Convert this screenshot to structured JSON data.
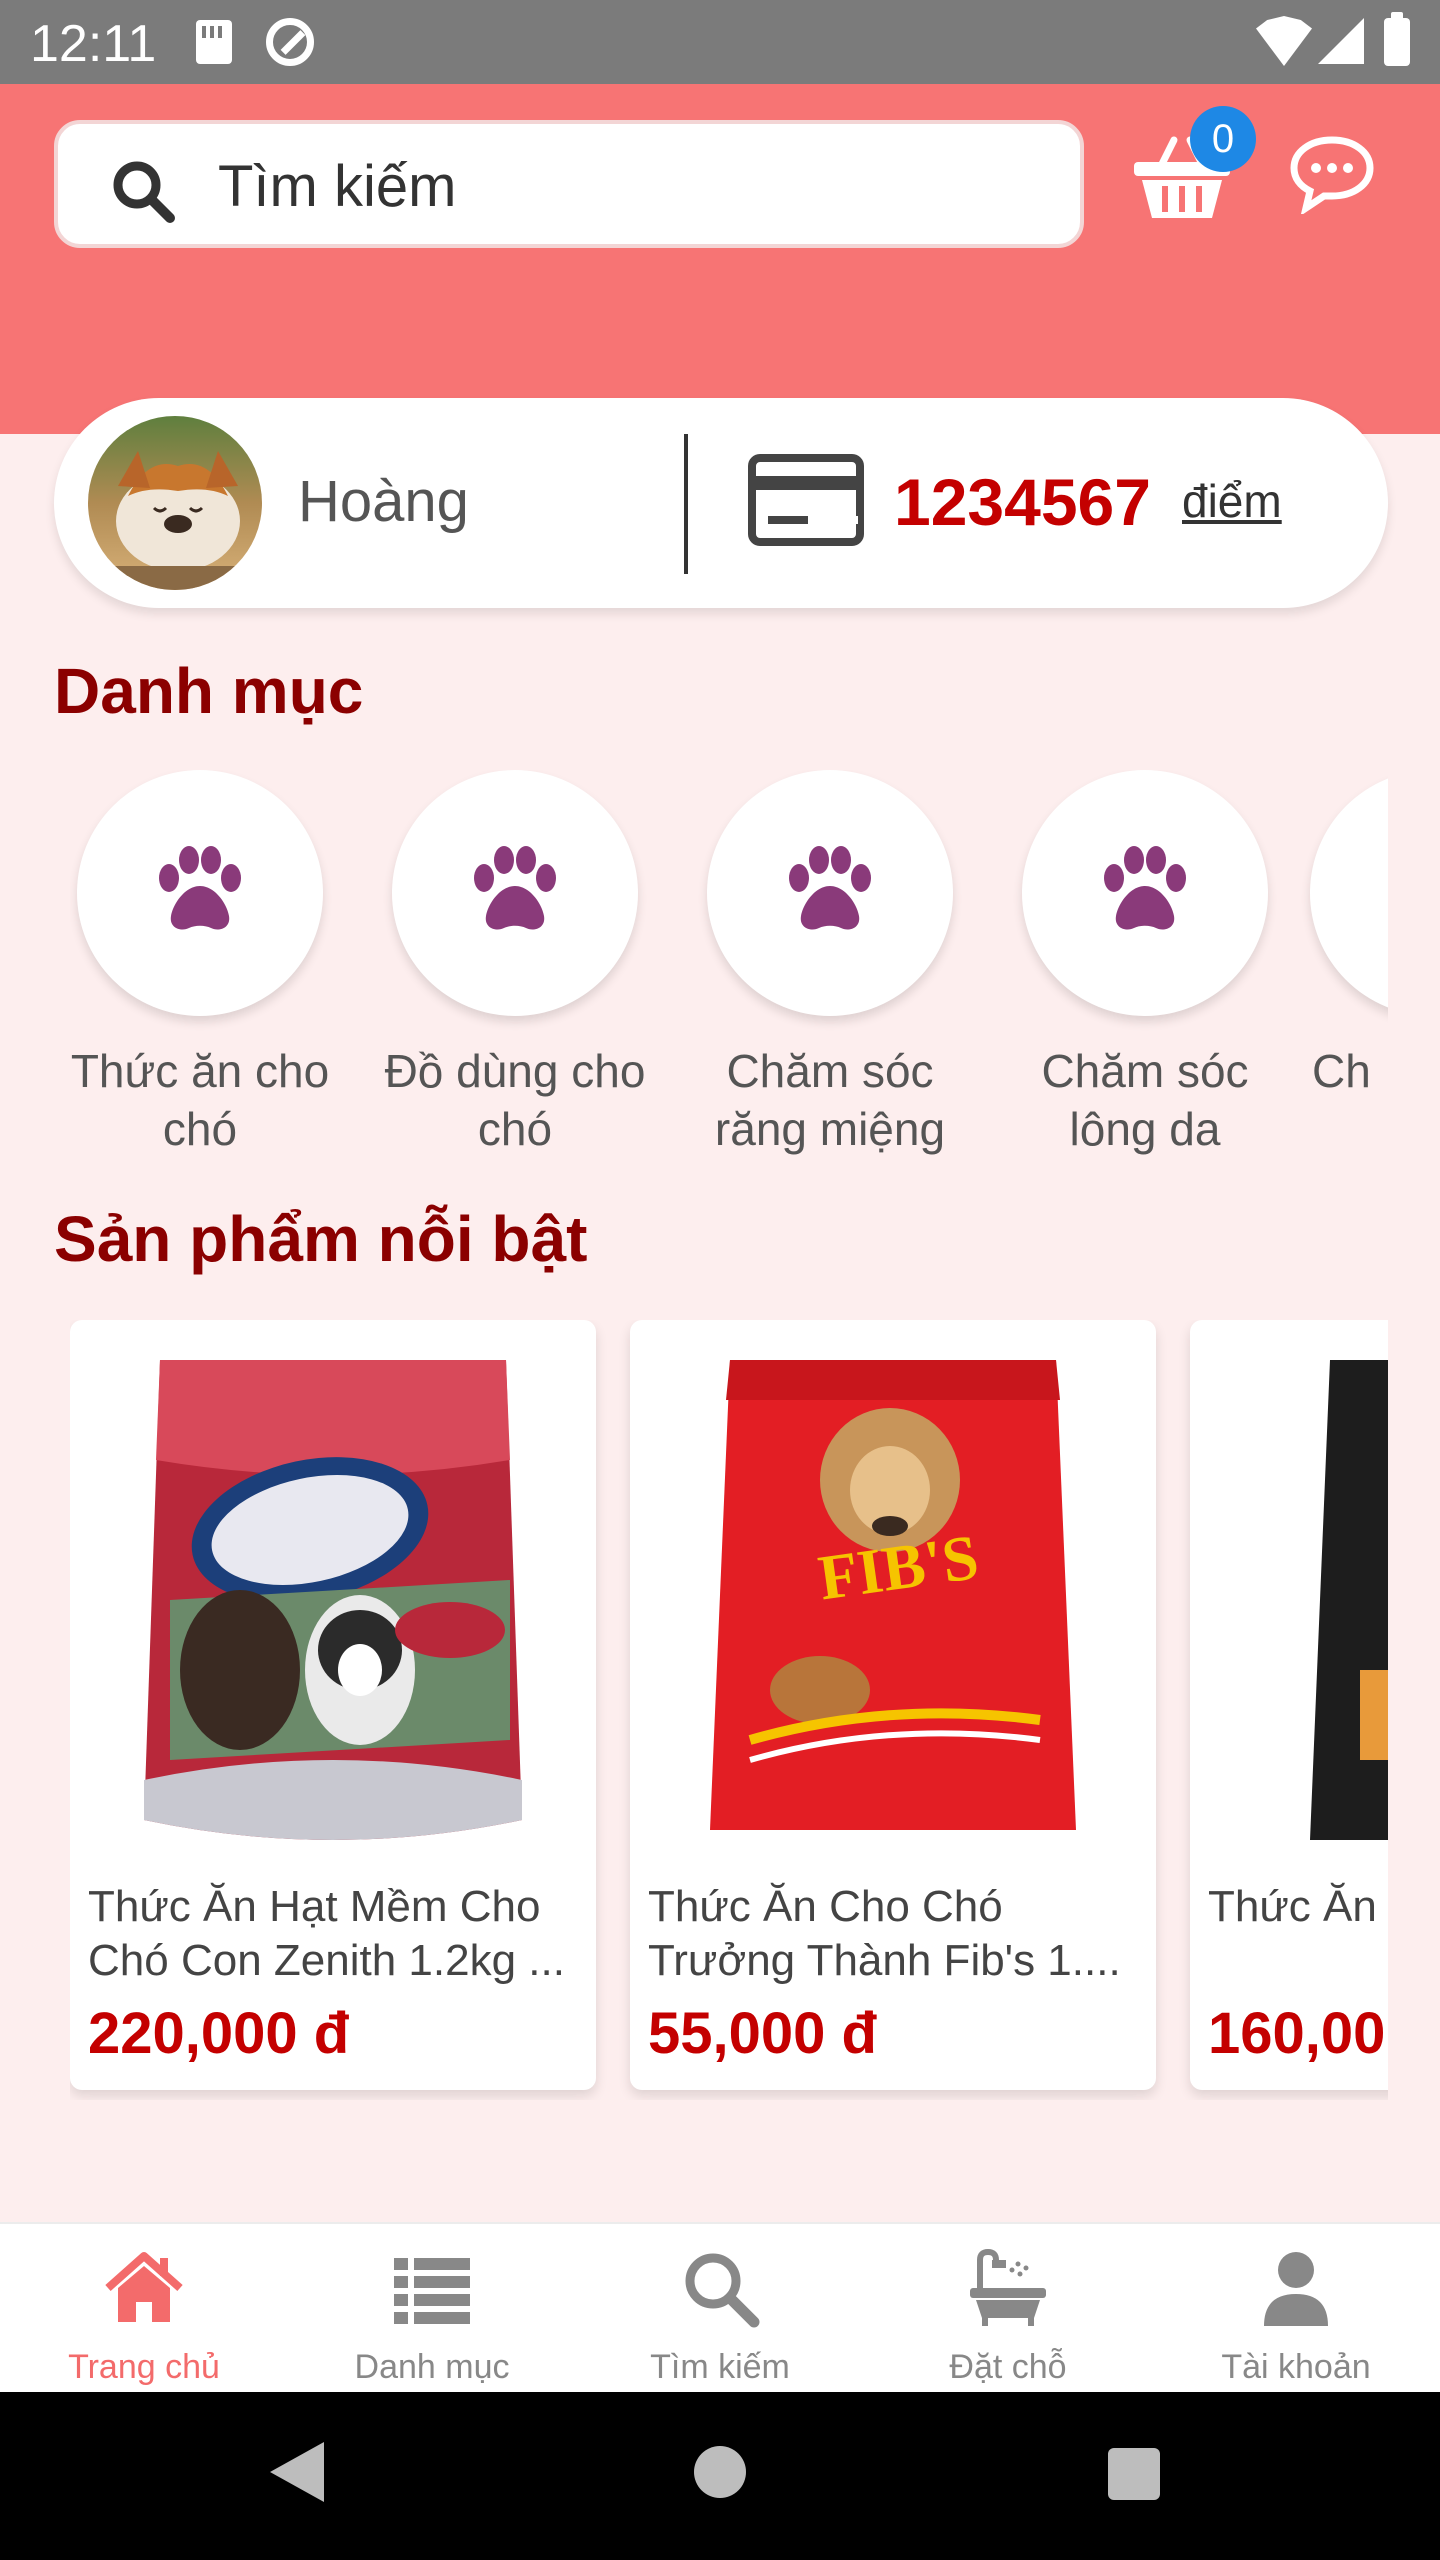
{
  "status_bar": {
    "time": "12:11"
  },
  "header": {
    "search_placeholder": "Tìm kiếm",
    "cart_count": "0"
  },
  "user": {
    "name": "Hoàng",
    "points": "1234567",
    "points_unit": "điểm"
  },
  "categories": {
    "title": "Danh mục",
    "items": [
      {
        "label": "Thức ăn cho chó"
      },
      {
        "label": "Đồ dùng cho chó"
      },
      {
        "label": "Chăm sóc răng miệng"
      },
      {
        "label": "Chăm sóc lông da"
      },
      {
        "label": "Ch"
      }
    ]
  },
  "featured": {
    "title": "Sản phẩm nỗi bật",
    "items": [
      {
        "name": "Thức Ăn Hạt Mềm Cho Chó Con Zenith 1.2kg ...",
        "price": "220,000 đ"
      },
      {
        "name": "Thức Ăn Cho Chó Trưởng Thành Fib's 1....",
        "price": "55,000 đ"
      },
      {
        "name": "Thức Ăn Trưởng T",
        "price": "160,00"
      }
    ]
  },
  "bottom_nav": {
    "items": [
      {
        "label": "Trang chủ",
        "active": true
      },
      {
        "label": "Danh mục"
      },
      {
        "label": "Tìm kiếm"
      },
      {
        "label": "Đặt chỗ"
      },
      {
        "label": "Tài khoản"
      }
    ]
  },
  "colors": {
    "header": "#f77474",
    "accent": "#8b0000",
    "price": "#c40000",
    "paw": "#8a3a7a",
    "badge": "#1e88e5"
  }
}
